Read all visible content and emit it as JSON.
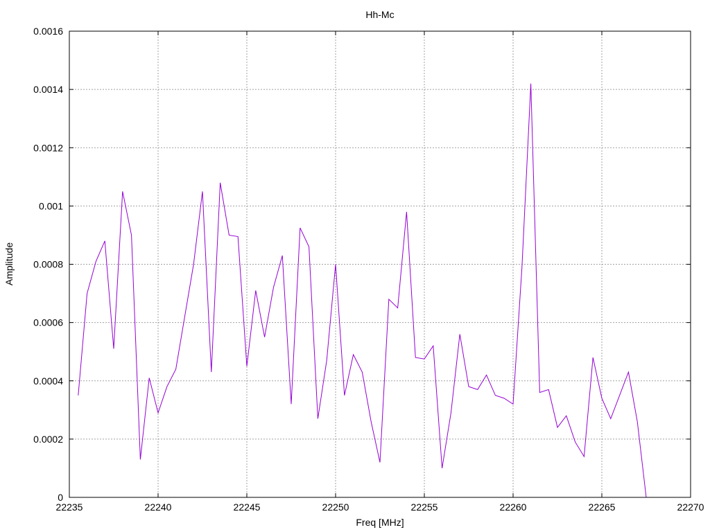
{
  "chart_data": {
    "type": "line",
    "title": "Hh-Mc",
    "xlabel": "Freq [MHz]",
    "ylabel": "Amplitude",
    "xlim": [
      22235,
      22270
    ],
    "ylim": [
      0,
      0.0016
    ],
    "x_ticks": [
      22235,
      22240,
      22245,
      22250,
      22255,
      22260,
      22265,
      22270
    ],
    "x_tick_labels": [
      "22235",
      "22240",
      "22245",
      "22250",
      "22255",
      "22260",
      "22265",
      "22270"
    ],
    "y_ticks": [
      0,
      0.0002,
      0.0004,
      0.0006,
      0.0008,
      0.001,
      0.0012,
      0.0014,
      0.0016
    ],
    "y_tick_labels": [
      "0",
      "0.0002",
      "0.0004",
      "0.0006",
      "0.0008",
      "0.001",
      "0.0012",
      "0.0014",
      "0.0016"
    ],
    "grid": true,
    "line_color": "#9400d3",
    "series": [
      {
        "x": [
          22235.5,
          22236.0,
          22236.5,
          22237.0,
          22237.5,
          22238.0,
          22238.5,
          22239.0,
          22239.5,
          22240.0,
          22240.5,
          22241.0,
          22241.5,
          22242.0,
          22242.5,
          22243.0,
          22243.5,
          22244.0,
          22244.5,
          22245.0,
          22245.5,
          22246.0,
          22246.5,
          22247.0,
          22247.5,
          22248.0,
          22248.5,
          22249.0,
          22249.5,
          22250.0,
          22250.5,
          22251.0,
          22251.5,
          22252.0,
          22252.5,
          22253.0,
          22253.5,
          22254.0,
          22254.5,
          22255.0,
          22255.5,
          22256.0,
          22256.5,
          22257.0,
          22257.5,
          22258.0,
          22258.5,
          22259.0,
          22259.5,
          22260.0,
          22260.5,
          22261.0,
          22261.5,
          22262.0,
          22262.5,
          22263.0,
          22263.5,
          22264.0,
          22264.5,
          22265.0,
          22265.5,
          22266.0,
          22266.5,
          22267.0,
          22267.5
        ],
        "values": [
          0.00035,
          0.0007,
          0.00081,
          0.00088,
          0.00051,
          0.00105,
          0.0009,
          0.00013,
          0.00041,
          0.00029,
          0.00038,
          0.00044,
          0.00062,
          0.0008,
          0.00105,
          0.00043,
          0.00108,
          0.0009,
          0.000895,
          0.00045,
          0.00071,
          0.00055,
          0.00072,
          0.00083,
          0.00032,
          0.000925,
          0.00086,
          0.00027,
          0.00047,
          0.0008,
          0.00035,
          0.00049,
          0.00043,
          0.00026,
          0.00012,
          0.00068,
          0.00065,
          0.00098,
          0.00048,
          0.000475,
          0.00052,
          0.0001,
          0.00029,
          0.00056,
          0.00038,
          0.00037,
          0.00042,
          0.00035,
          0.00034,
          0.00032,
          0.00079,
          0.00142,
          0.00036,
          0.00037,
          0.00024,
          0.00028,
          0.00019,
          0.00014,
          0.00048,
          0.00034,
          0.00027,
          0.00035,
          0.00043,
          0.00026,
          0.0
        ]
      }
    ]
  }
}
